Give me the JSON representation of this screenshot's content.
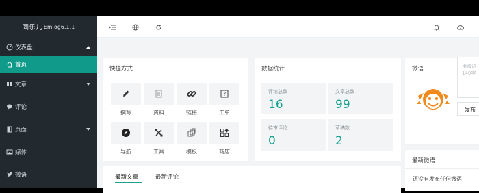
{
  "app": {
    "brand": "同乐儿",
    "version": "Emlog6.1.1"
  },
  "sidebar": {
    "items": [
      {
        "label": "仪表盘",
        "icon": "dashboard-icon"
      },
      {
        "label": "首页",
        "icon": "home-icon"
      },
      {
        "label": "文章",
        "icon": "article-icon"
      },
      {
        "label": "评论",
        "icon": "comment-icon"
      },
      {
        "label": "页面",
        "icon": "page-icon"
      },
      {
        "label": "媒体",
        "icon": "image-icon"
      },
      {
        "label": "微语",
        "icon": "twitter-icon"
      }
    ]
  },
  "topbar": {
    "icons": [
      "menu-collapse-icon",
      "globe-icon",
      "refresh-icon",
      "bell-icon",
      "cloud-icon"
    ]
  },
  "quick": {
    "title": "快捷方式",
    "items": [
      {
        "label": "撰写",
        "icon": "pencil-icon"
      },
      {
        "label": "资料",
        "icon": "document-icon"
      },
      {
        "label": "链接",
        "icon": "link-icon"
      },
      {
        "label": "工单",
        "icon": "ticket-icon"
      },
      {
        "label": "导航",
        "icon": "compass-icon"
      },
      {
        "label": "工具",
        "icon": "tools-icon"
      },
      {
        "label": "模板",
        "icon": "template-icon"
      },
      {
        "label": "商店",
        "icon": "store-icon"
      }
    ]
  },
  "stats": {
    "title": "数据统计",
    "items": [
      {
        "label": "评论总数",
        "value": "16"
      },
      {
        "label": "文章总数",
        "value": "99"
      },
      {
        "label": "待审评论",
        "value": "0"
      },
      {
        "label": "草稿数",
        "value": "2"
      }
    ]
  },
  "weiyu": {
    "title": "微语",
    "placeholder": "用微语\n140字",
    "button": "发布"
  },
  "latest_weiyu": {
    "title": "最新微语",
    "empty": "还没有发布任何微语"
  },
  "articles": {
    "tabs": [
      "最新文章",
      "最新评论"
    ]
  },
  "colors": {
    "accent": "#0f9a8a",
    "sidebar_bg": "#222a2f"
  }
}
